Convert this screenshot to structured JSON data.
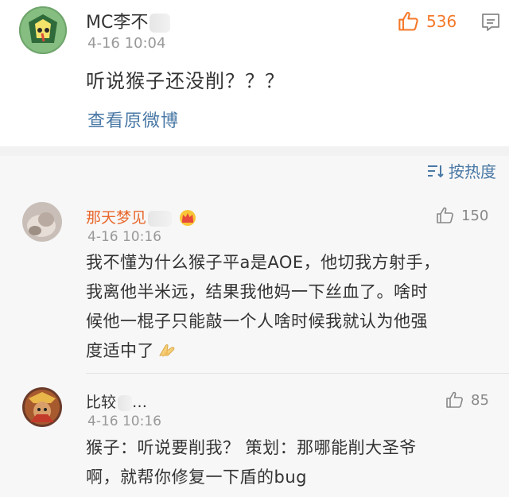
{
  "post": {
    "username": "MC李不",
    "time": "4-16 10:04",
    "text": "听说猴子还没削？？？",
    "likes": "536",
    "view_original": "查看原微博"
  },
  "sort": {
    "label": "按热度"
  },
  "comments": [
    {
      "name": "那天梦见",
      "time": "4-16 10:16",
      "likes": "150",
      "lines": [
        "我不懂为什么猴子平a是AOE，他切我方射手，",
        "我离他半米远，结果我他妈一下丝血了。啥时",
        "候他一棍子只能敲一个人啥时候我就认为他强",
        "度适中了"
      ],
      "name_color": "#e8682c"
    },
    {
      "name": "比较",
      "name_suffix": "…",
      "time": "4-16 10:16",
      "likes": "85",
      "lines": [
        "猴子：听说要削我？ 策划：那哪能削大圣爷",
        "啊，就帮你修复一下盾的bug"
      ],
      "name_color": "#333333"
    }
  ],
  "colors": {
    "accent_link": "#4a79a6",
    "like_orange": "#f5792a",
    "vip_name": "#e8682c"
  },
  "icons": {
    "like": "thumbs-up-icon",
    "menu": "comment-menu-icon",
    "sort": "sort-icon",
    "crown": "crown-badge-icon",
    "clap": "pray-hands-emoji-icon"
  }
}
